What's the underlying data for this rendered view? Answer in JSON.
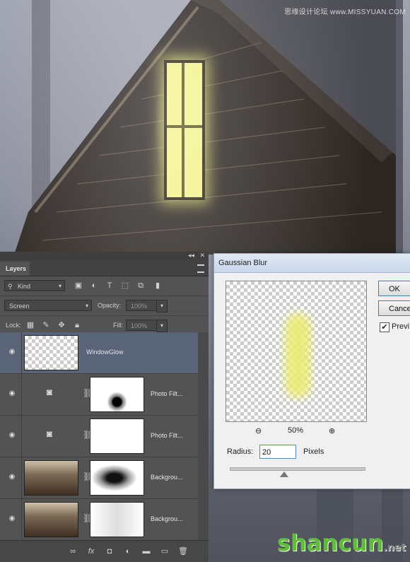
{
  "watermark": "思缘设计论坛 www.MISSYUAN.COM",
  "logo": {
    "main": "shancun",
    "sub": ".net"
  },
  "layers_panel": {
    "tab_label": "Layers",
    "kind_filter": "Kind",
    "blend_mode": "Screen",
    "opacity_label": "Opacity:",
    "opacity_value": "100%",
    "lock_label": "Lock:",
    "fill_label": "Fill:",
    "fill_value": "100%",
    "layers": [
      {
        "name": "WindowGlow",
        "active": true
      },
      {
        "name": "Photo Filt..."
      },
      {
        "name": "Photo Filt..."
      },
      {
        "name": "Backgrou..."
      },
      {
        "name": "Backgrou..."
      }
    ]
  },
  "dialog": {
    "title": "Gaussian Blur",
    "ok_label": "OK",
    "cancel_label": "Cance",
    "preview_label": "Previ",
    "preview_checked": "✔",
    "zoom": "50%",
    "radius_label": "Radius:",
    "radius_value": "20",
    "unit_label": "Pixels",
    "slider_fraction": 0.4
  }
}
